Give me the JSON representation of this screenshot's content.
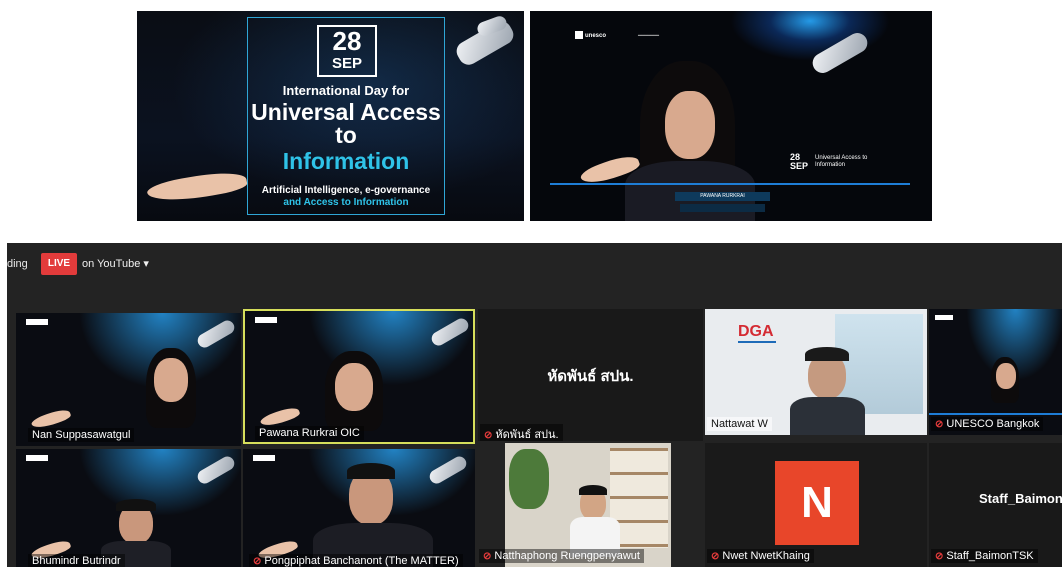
{
  "poster": {
    "day": "28",
    "month": "SEP",
    "line1": "International Day for",
    "line2": "Universal Access to",
    "line3": "Information",
    "line4": "Artificial Intelligence, e-governance",
    "line5": "and Access to Information"
  },
  "speaker_slide": {
    "org": "unesco",
    "day": "28",
    "month": "SEP",
    "title": "Universal Access to Information",
    "name": "PAWANA RURKRAI"
  },
  "zoom": {
    "recording_partial": "ding",
    "live_label": "LIVE",
    "live_destination": "on YouTube ▾",
    "tiles": [
      {
        "label": "Nan Suppasawatgul",
        "muted": false
      },
      {
        "label": "Pawana Rurkrai OIC",
        "muted": false
      },
      {
        "label": "หัดพันธ์ สปน.",
        "muted": true,
        "center_text": "หัดพันธ์ สปน."
      },
      {
        "label": "Nattawat W",
        "muted": false,
        "logo": "DGA"
      },
      {
        "label": "UNESCO Bangkok",
        "muted": true
      },
      {
        "label": "Bhumindr Butrindr",
        "muted": false
      },
      {
        "label": "Pongpiphat Banchanont (The MATTER)",
        "muted": true
      },
      {
        "label": "Natthaphong Ruengpenyawut",
        "muted": true
      },
      {
        "label": "Nwet NwetKhaing",
        "muted": true,
        "initial": "N"
      },
      {
        "label": "Staff_BaimonTSK",
        "muted": true,
        "center_text": "Staff_Baimon"
      }
    ]
  },
  "colors": {
    "live_red": "#e23b3b",
    "active_speaker": "#d6de5b",
    "accent_cyan": "#2fc3e8",
    "avatar_orange": "#e8462a"
  }
}
